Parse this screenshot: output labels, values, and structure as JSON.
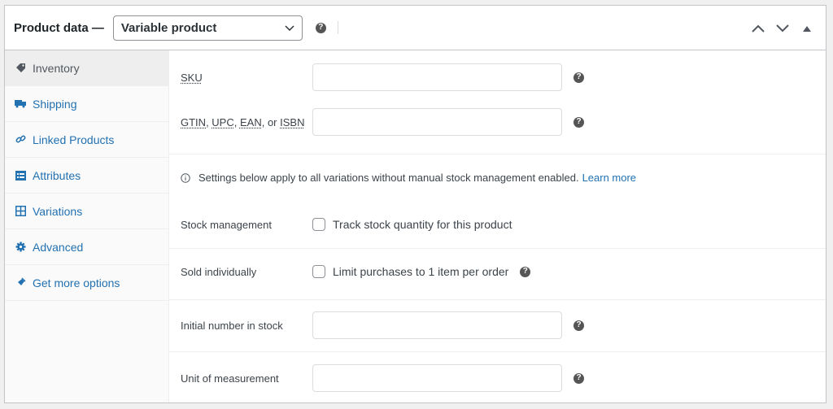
{
  "header": {
    "title": "Product data —",
    "product_type": "Variable product"
  },
  "sidebar": {
    "items": [
      {
        "label": "Inventory",
        "icon": "tag-icon",
        "active": true
      },
      {
        "label": "Shipping",
        "icon": "truck-icon"
      },
      {
        "label": "Linked Products",
        "icon": "link-icon"
      },
      {
        "label": "Attributes",
        "icon": "list-icon"
      },
      {
        "label": "Variations",
        "icon": "grid-icon"
      },
      {
        "label": "Advanced",
        "icon": "gear-icon"
      },
      {
        "label": "Get more options",
        "icon": "plugin-icon"
      }
    ]
  },
  "fields": {
    "sku": {
      "label": "SKU",
      "value": ""
    },
    "gtin": {
      "label_parts": [
        "GTIN",
        ", ",
        "UPC",
        ", ",
        "EAN",
        ", or ",
        "ISBN"
      ],
      "value": ""
    },
    "notice": {
      "text": "Settings below apply to all variations without manual stock management enabled.",
      "link": "Learn more"
    },
    "stock_management": {
      "label": "Stock management",
      "checkbox_label": "Track stock quantity for this product",
      "checked": false
    },
    "sold_individually": {
      "label": "Sold individually",
      "checkbox_label": "Limit purchases to 1 item per order",
      "checked": false
    },
    "initial_stock": {
      "label": "Initial number in stock",
      "value": ""
    },
    "unit": {
      "label": "Unit of measurement",
      "value": ""
    }
  },
  "help_glyph": "?",
  "colors": {
    "link": "#2271b1",
    "active_tab_bg": "#eeeeee"
  }
}
